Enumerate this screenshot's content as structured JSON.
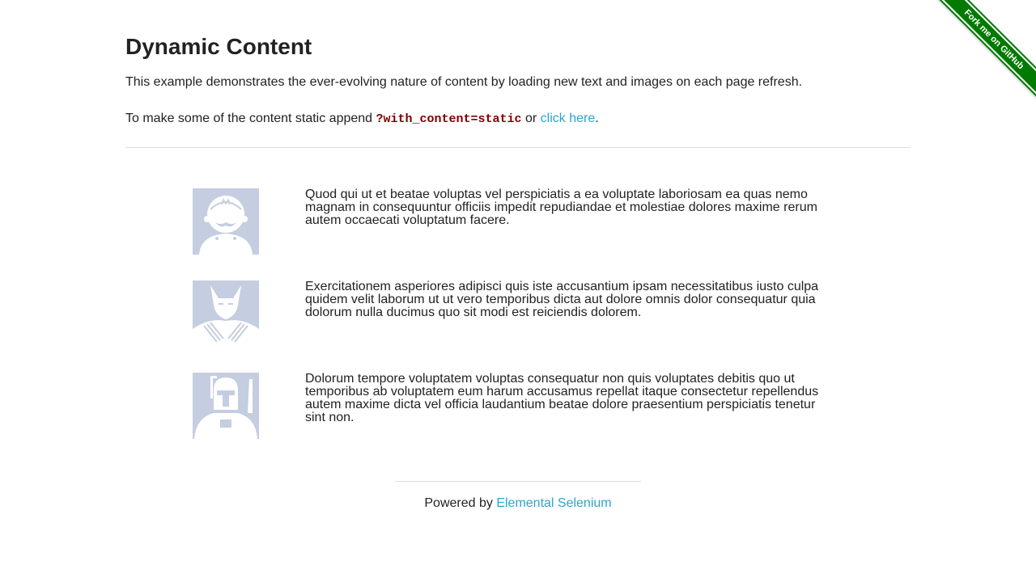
{
  "ribbon": {
    "label": "Fork me on GitHub",
    "color": "#007a00"
  },
  "header": {
    "title": "Dynamic Content",
    "description": "This example demonstrates the ever-evolving nature of content by loading new text and images on each page refresh.",
    "static_prefix": "To make some of the content static append ",
    "static_code": "?with_content=static",
    "static_mid": " or ",
    "static_link": "click here",
    "static_suffix": "."
  },
  "rows": [
    {
      "avatar_icon": "mario-avatar-icon",
      "text": "Quod qui ut et beatae voluptas vel perspiciatis a ea voluptate laboriosam ea quas nemo magnam in consequuntur officiis impedit repudiandae et molestiae dolores maxime rerum autem occaecati voluptatum facere."
    },
    {
      "avatar_icon": "wolverine-avatar-icon",
      "text": "Exercitationem asperiores adipisci quis iste accusantium ipsam necessitatibus iusto culpa quidem velit laborum ut ut vero temporibus dicta aut dolore omnis dolor consequatur quia dolorum nulla ducimus quo sit modi est reiciendis dolorem."
    },
    {
      "avatar_icon": "bounty-hunter-avatar-icon",
      "text": "Dolorum tempore voluptatem voluptas consequatur non quis voluptates debitis quo ut temporibus ab voluptatem eum harum accusamus repellat itaque consectetur repellendus autem maxime dicta vel officia laudantium beatae dolore praesentium perspiciatis tenetur sint non."
    }
  ],
  "footer": {
    "prefix": "Powered by ",
    "link": "Elemental Selenium"
  },
  "colors": {
    "link": "#2ba6cb",
    "code": "#7f0000",
    "avatar_bg": "#c5cde0"
  }
}
